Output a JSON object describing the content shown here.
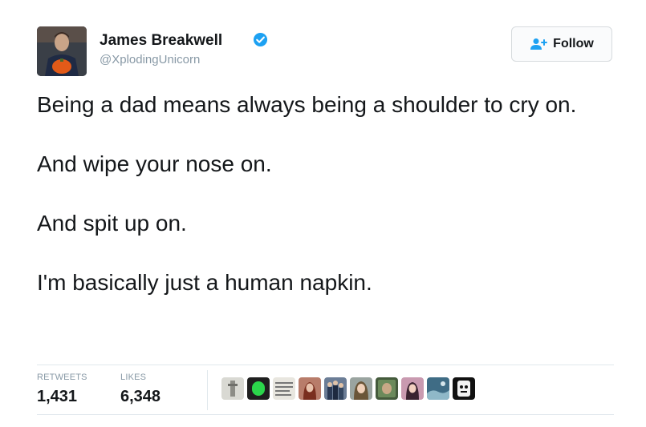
{
  "user": {
    "name": "James Breakwell",
    "handle": "@XplodingUnicorn",
    "verified": true
  },
  "follow_button": {
    "label": "Follow",
    "icon": "add-user-icon"
  },
  "tweet": {
    "paragraphs": [
      "Being a dad means always being a shoulder to cry on.",
      "And wipe your nose on.",
      "And spit up on.",
      "I'm basically just a human napkin."
    ]
  },
  "stats": {
    "retweets_label": "RETWEETS",
    "retweets_value": "1,431",
    "likes_label": "LIKES",
    "likes_value": "6,348"
  },
  "likers_count_shown": 10,
  "colors": {
    "verified_badge": "#1da1f2",
    "muted_text": "#8899a6",
    "divider": "#e1e8ed",
    "text": "#14171a"
  }
}
